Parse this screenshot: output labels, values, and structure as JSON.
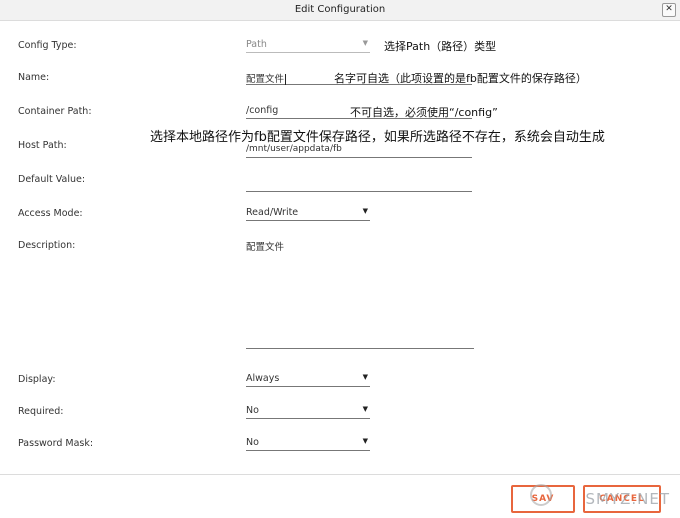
{
  "dialog": {
    "title": "Edit Configuration",
    "close_label": "✕"
  },
  "form": {
    "config_type": {
      "label": "Config Type:",
      "value": "Path",
      "note": "选择Path（路径）类型"
    },
    "name": {
      "label": "Name:",
      "value": "配置文件",
      "note": "名字可自选（此项设置的是fb配置文件的保存路径）"
    },
    "container_path": {
      "label": "Container Path:",
      "value": "/config",
      "note": "不可自选，必须使用“/config”"
    },
    "host_path": {
      "label": "Host Path:",
      "value": "/mnt/user/appdata/fb",
      "note": "选择本地路径作为fb配置文件保存路径，如果所选路径不存在，系统会自动生成"
    },
    "default_value": {
      "label": "Default Value:",
      "value": ""
    },
    "access_mode": {
      "label": "Access Mode:",
      "value": "Read/Write"
    },
    "description": {
      "label": "Description:",
      "value": "配置文件"
    },
    "display": {
      "label": "Display:",
      "value": "Always"
    },
    "required": {
      "label": "Required:",
      "value": "No"
    },
    "password_mask": {
      "label": "Password Mask:",
      "value": "No"
    }
  },
  "buttons": {
    "save": "SAV",
    "cancel": "CANCEL"
  },
  "watermark": "SMYZ.NET",
  "colors": {
    "accent": "#e8663d",
    "border": "#777777"
  }
}
